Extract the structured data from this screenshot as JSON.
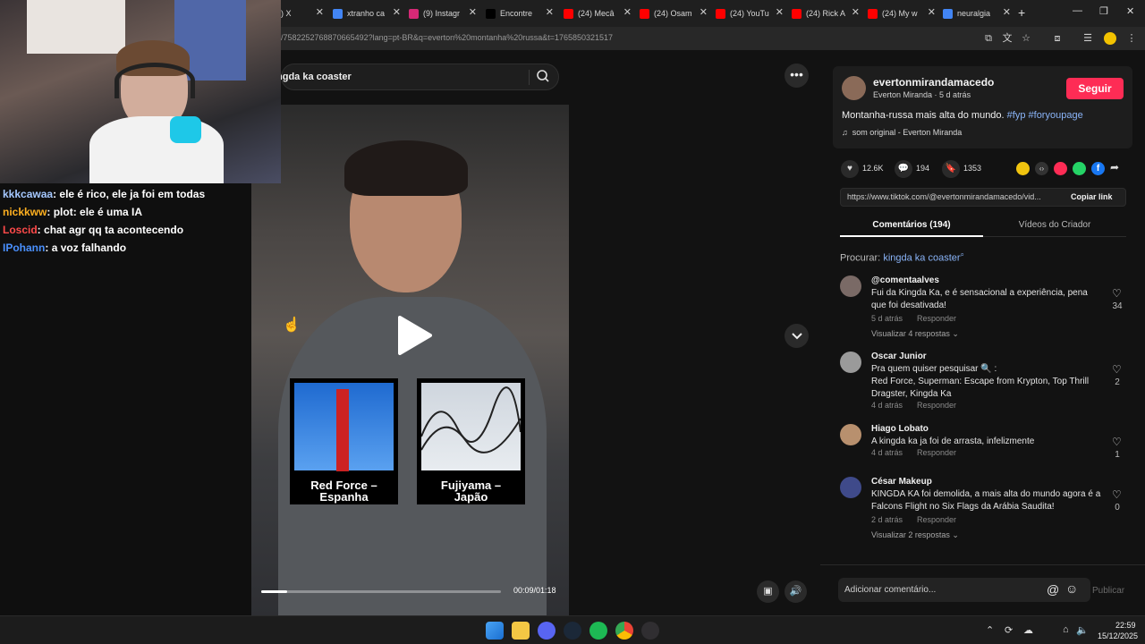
{
  "browser": {
    "tabs": [
      {
        "label": ") X",
        "color": "#000000"
      },
      {
        "label": "xtranho ca",
        "color": "#4285f4"
      },
      {
        "label": "(9) Instagr",
        "color": "#d62976"
      },
      {
        "label": "Encontre",
        "color": "#000000"
      },
      {
        "label": "(24) Mecâ",
        "color": "#ff0000"
      },
      {
        "label": "(24) Osam",
        "color": "#ff0000"
      },
      {
        "label": "(24) YouTu",
        "color": "#ff0000"
      },
      {
        "label": "(24) Rick A",
        "color": "#ff0000"
      },
      {
        "label": "(24) My w",
        "color": "#ff0000"
      },
      {
        "label": "neuralgia",
        "color": "#4285f4"
      }
    ],
    "new_tab": "+",
    "url": "/7582252768870665492?lang=pt-BR&q=everton%20montanha%20russa&t=1765850321517"
  },
  "chat": {
    "lines": [
      {
        "user": "kkkcawaa",
        "color": "#a5c8ff",
        "text": "ele é rico, ele ja foi em todas"
      },
      {
        "user": "nickkww",
        "color": "#ffb020",
        "text": "plot: ele é uma IA"
      },
      {
        "user": "Loscid",
        "color": "#ff4a4a",
        "text": "chat   agr qq ta acontecendo"
      },
      {
        "user": "IPohann",
        "color": "#4a90ff",
        "text": "a voz falhando"
      }
    ]
  },
  "video": {
    "search_text": "ngda ka coaster",
    "current_time": "00:09/01:18",
    "progress": 0.11,
    "overlay_cards": [
      {
        "title": "Red Force –",
        "subtitle": "Espanha"
      },
      {
        "title": "Fujiyama –",
        "subtitle": "Japão"
      }
    ]
  },
  "post": {
    "username": "evertonmirandamacedo",
    "display_name": "Everton Miranda",
    "time_ago": "5 d atrás",
    "follow_label": "Seguir",
    "caption": "Montanha-russa mais alta do mundo.",
    "hashtags": "#fyp #foryoupage",
    "sound": "som original - Everton Miranda",
    "likes": "12.6K",
    "comments": "194",
    "saves": "1353",
    "link": "https://www.tiktok.com/@evertonmirandamacedo/vid...",
    "copy_label": "Copiar link",
    "tab_comments": "Comentários (194)",
    "tab_creator": "Vídeos do Criador",
    "search_label": "Procurar:",
    "search_term": "kingda ka coaster"
  },
  "comments": [
    {
      "name": "@comentaalves",
      "text": "Fui da Kingda Ka, e é sensacional a experiência, pena que foi desativada!",
      "date": "5 d atrás",
      "reply": "Responder",
      "likes": "34",
      "view_replies": "Visualizar 4 respostas"
    },
    {
      "name": "Oscar Junior",
      "text": "Pra quem quiser pesquisar 🔍 :",
      "text2": "Red Force, Superman: Escape from Krypton, Top Thrill Dragster, Kingda Ka",
      "date": "4 d atrás",
      "reply": "Responder",
      "likes": "2"
    },
    {
      "name": "Hiago Lobato",
      "text": "A kingda ka ja foi de arrasta, infelizmente",
      "date": "4 d atrás",
      "reply": "Responder",
      "likes": "1"
    },
    {
      "name": "César Makeup",
      "text": "KINGDA KA foi demolida, a mais alta do mundo agora é a Falcons Flight no Six Flags da Arábia Saudita!",
      "date": "2 d atrás",
      "reply": "Responder",
      "likes": "0",
      "view_replies": "Visualizar 2 respostas"
    }
  ],
  "comment_input": {
    "placeholder": "Adicionar comentário...",
    "publish": "Publicar"
  },
  "taskbar": {
    "time": "22:59",
    "date": "15/12/2025"
  }
}
